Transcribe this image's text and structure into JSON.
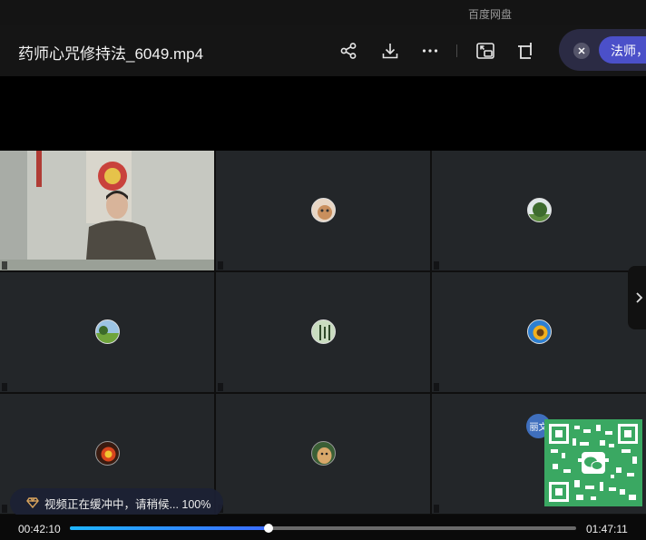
{
  "app": {
    "name": "百度网盘"
  },
  "header": {
    "title": "药师心咒修持法_6049.mp4",
    "buttons": [
      {
        "name": "share-icon"
      },
      {
        "name": "download-icon"
      },
      {
        "name": "more-icon"
      },
      {
        "name": "picture-in-picture-icon"
      },
      {
        "name": "mini-window-icon"
      }
    ]
  },
  "notice": {
    "text": "法师，"
  },
  "video": {
    "tiles": [
      {
        "label": "",
        "avatar": "host-video"
      },
      {
        "label": "",
        "avatar": "pet-photo"
      },
      {
        "label": "",
        "avatar": "tree-photo"
      },
      {
        "label": "",
        "avatar": "landscape-photo"
      },
      {
        "label": "",
        "avatar": "calligraphy-photo"
      },
      {
        "label": "",
        "avatar": "sunflower-photo"
      },
      {
        "label": "",
        "avatar": "flower-photo"
      },
      {
        "label": "",
        "avatar": "puppy-photo"
      },
      {
        "label": "",
        "avatar": "text-avatar",
        "avatar_text": "丽文"
      }
    ]
  },
  "buffering": {
    "text": "视频正在缓冲中，请稍候... 100%"
  },
  "player": {
    "current_time": "00:42:10",
    "total_time": "01:47:11",
    "progress": 0.393
  },
  "colors": {
    "accent": "#3b6cff",
    "qr": "#3aa862",
    "notice": "#4b50c9"
  }
}
